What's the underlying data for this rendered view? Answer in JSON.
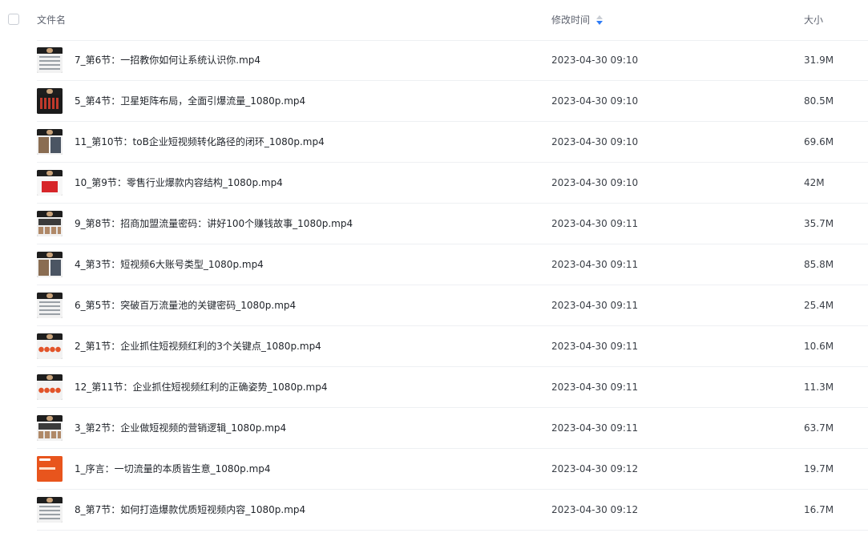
{
  "header": {
    "name_label": "文件名",
    "time_label": "修改时间",
    "size_label": "大小",
    "sort_icon": "sort-desc-icon",
    "accent_color": "#2f7cf6"
  },
  "files": [
    {
      "name": "7_第6节：一招教你如何让系统认识你.mp4",
      "time": "2023-04-30 09:10",
      "size": "31.9M",
      "thumb": "doc"
    },
    {
      "name": "5_第4节：卫星矩阵布局，全面引爆流量_1080p.mp4",
      "time": "2023-04-30 09:10",
      "size": "80.5M",
      "thumb": "dark"
    },
    {
      "name": "11_第10节：toB企业短视频转化路径的闭环_1080p.mp4",
      "time": "2023-04-30 09:10",
      "size": "69.6M",
      "thumb": "photo"
    },
    {
      "name": "10_第9节：零售行业爆款内容结构_1080p.mp4",
      "time": "2023-04-30 09:10",
      "size": "42M",
      "thumb": "red"
    },
    {
      "name": "9_第8节：招商加盟流量密码：讲好100个赚钱故事_1080p.mp4",
      "time": "2023-04-30 09:11",
      "size": "35.7M",
      "thumb": "mixed"
    },
    {
      "name": "4_第3节：短视频6大账号类型_1080p.mp4",
      "time": "2023-04-30 09:11",
      "size": "85.8M",
      "thumb": "photo"
    },
    {
      "name": "6_第5节：突破百万流量池的关键密码_1080p.mp4",
      "time": "2023-04-30 09:11",
      "size": "25.4M",
      "thumb": "doc"
    },
    {
      "name": "2_第1节：企业抓住短视频红利的3个关键点_1080p.mp4",
      "time": "2023-04-30 09:11",
      "size": "10.6M",
      "thumb": "dots"
    },
    {
      "name": "12_第11节：企业抓住短视频红利的正确姿势_1080p.mp4",
      "time": "2023-04-30 09:11",
      "size": "11.3M",
      "thumb": "dots"
    },
    {
      "name": "3_第2节：企业做短视频的营销逻辑_1080p.mp4",
      "time": "2023-04-30 09:11",
      "size": "63.7M",
      "thumb": "mixed"
    },
    {
      "name": "1_序言：一切流量的本质皆生意_1080p.mp4",
      "time": "2023-04-30 09:12",
      "size": "19.7M",
      "thumb": "orange"
    },
    {
      "name": "8_第7节：如何打造爆款优质短视频内容_1080p.mp4",
      "time": "2023-04-30 09:12",
      "size": "16.7M",
      "thumb": "doc"
    }
  ]
}
